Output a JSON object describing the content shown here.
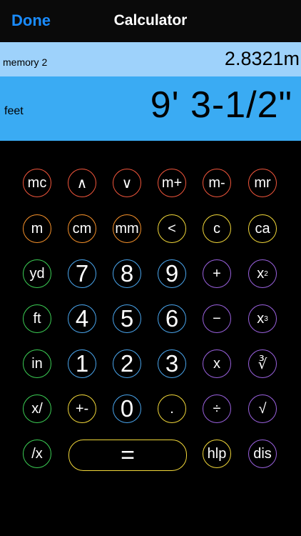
{
  "navbar": {
    "done_label": "Done",
    "title": "Calculator"
  },
  "memory": {
    "label": "memory 2",
    "value": "2.8321m"
  },
  "display": {
    "unit": "feet",
    "value": "9' 3-1/2\""
  },
  "keypad": {
    "row1": [
      "mc",
      "∧",
      "∨",
      "m+",
      "m-",
      "mr"
    ],
    "row2": [
      "m",
      "cm",
      "mm",
      "<",
      "c",
      "ca"
    ],
    "row3": [
      "yd",
      "7",
      "8",
      "9",
      "+",
      "x"
    ],
    "row3_exp": "2",
    "row4": [
      "ft",
      "4",
      "5",
      "6",
      "−",
      "x"
    ],
    "row4_exp": "3",
    "row5": [
      "in",
      "1",
      "2",
      "3",
      "x",
      "∛"
    ],
    "row6": [
      "x/",
      "+-",
      "0",
      ".",
      "÷",
      "√"
    ],
    "row7": [
      "/x",
      "=",
      "hlp",
      "dis"
    ]
  },
  "colors": {
    "red": "#f2563c",
    "orange": "#f7922b",
    "yellow": "#f2d83a",
    "green": "#3ccf55",
    "blue": "#4aa6ee",
    "purple": "#9b62e0",
    "display_bg": "#3aabf3",
    "memory_bg": "#9ed2fb",
    "done": "#1a8cff"
  }
}
